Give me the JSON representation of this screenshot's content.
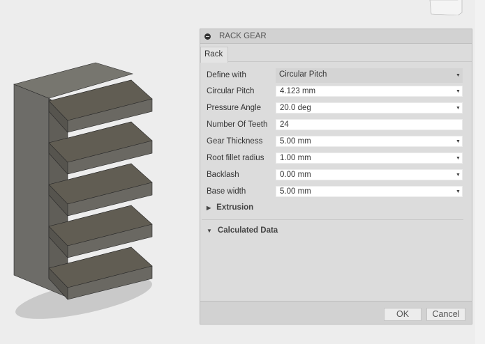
{
  "dialog": {
    "title": "RACK GEAR",
    "tab": "Rack",
    "fields": [
      {
        "label": "Define with",
        "value": "Circular Pitch",
        "type": "select"
      },
      {
        "label": "Circular Pitch",
        "value": "4.123 mm",
        "type": "dropdown-input"
      },
      {
        "label": "Pressure Angle",
        "value": "20.0 deg",
        "type": "dropdown-input"
      },
      {
        "label": "Number Of Teeth",
        "value": "24",
        "type": "input"
      },
      {
        "label": "Gear Thickness",
        "value": "5.00 mm",
        "type": "dropdown-input"
      },
      {
        "label": "Root fillet radius",
        "value": "1.00 mm",
        "type": "dropdown-input"
      },
      {
        "label": "Backlash",
        "value": "0.00 mm",
        "type": "dropdown-input"
      },
      {
        "label": "Base width",
        "value": "5.00 mm",
        "type": "dropdown-input"
      }
    ],
    "sections": {
      "extrusion": "Extrusion",
      "calculated": "Calculated Data"
    },
    "ok": "OK",
    "cancel": "Cancel"
  },
  "colors": {
    "model_side": "#6b6a66",
    "model_top": "#5d5a52",
    "background": "#ededed"
  }
}
